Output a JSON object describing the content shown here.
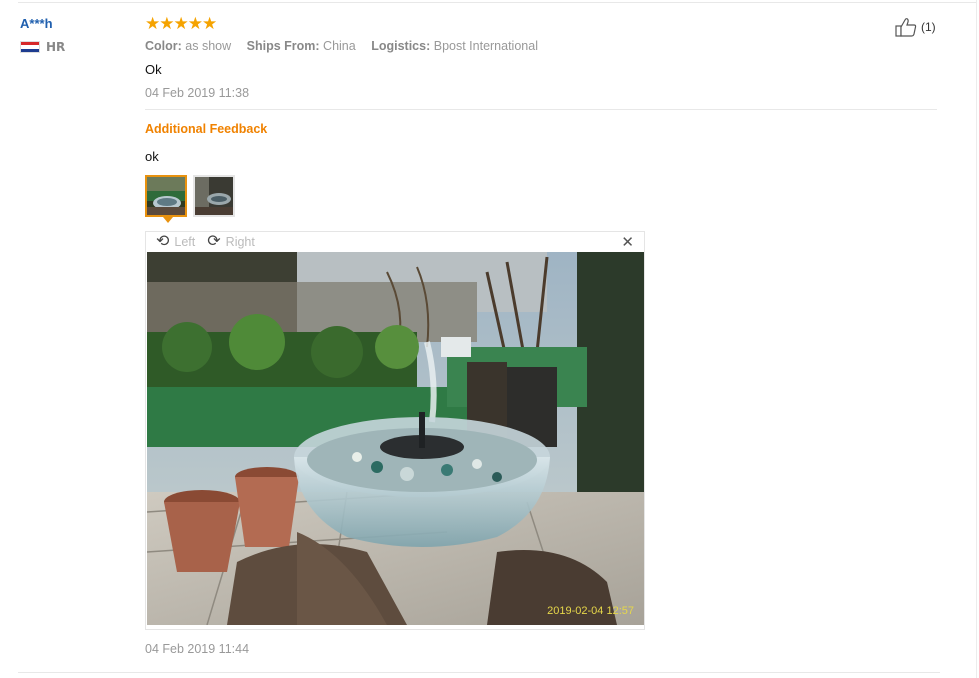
{
  "buyer": {
    "name": "A***h",
    "country_code": "HR",
    "flag_colors": [
      "#d62828",
      "#ffffff",
      "#1d3c8f"
    ]
  },
  "review": {
    "rating": 5,
    "attributes": [
      {
        "label": "Color:",
        "value": "as show"
      },
      {
        "label": "Ships From:",
        "value": "China"
      },
      {
        "label": "Logistics:",
        "value": "Bpost International"
      }
    ],
    "text": "Ok",
    "date": "04 Feb 2019 11:38"
  },
  "additional": {
    "title": "Additional Feedback",
    "text": "ok",
    "thumbnail_count": 2,
    "selected_thumbnail": 1,
    "viewer": {
      "rotate_left_label": "Left",
      "rotate_right_label": "Right",
      "photo_stamp": "2019-02-04 12:57"
    },
    "date": "04 Feb 2019 11:44"
  },
  "helpful": {
    "count": "(1)"
  },
  "colors": {
    "accent_orange": "#f08200",
    "star_color": "#f5a300",
    "name_blue": "#1f5fae"
  }
}
